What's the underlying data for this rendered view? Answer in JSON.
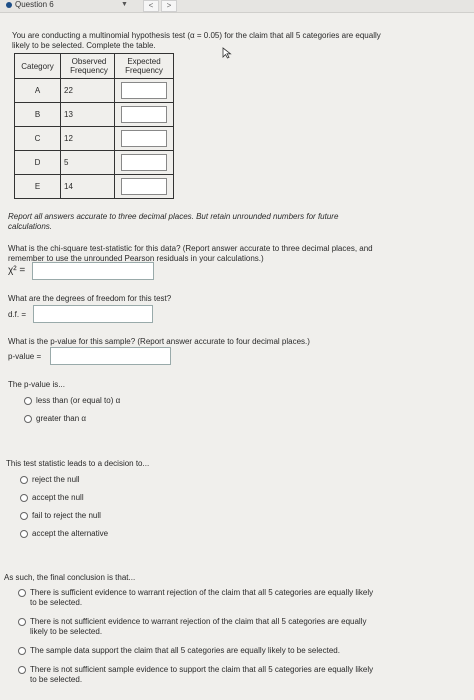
{
  "header": {
    "question_label": "Question 6",
    "prev": "<",
    "next": ">",
    "caret": "▼"
  },
  "intro": {
    "line1": "You are conducting a multinomial hypothesis test (α = 0.05) for the claim that all 5 categories are equally",
    "line2": "likely to be selected. Complete the table."
  },
  "table": {
    "headers": [
      "Category",
      "Observed Frequency",
      "Expected Frequency"
    ],
    "rows": [
      {
        "category": "A",
        "observed": "22"
      },
      {
        "category": "B",
        "observed": "13"
      },
      {
        "category": "C",
        "observed": "12"
      },
      {
        "category": "D",
        "observed": "5"
      },
      {
        "category": "E",
        "observed": "14"
      }
    ]
  },
  "report_note": {
    "line1": "Report all answers accurate to three decimal places. But retain unrounded numbers for future",
    "line2": "calculations."
  },
  "chi": {
    "line1": "What is the chi-square test-statistic for this data? (Report answer accurate to three decimal places, and",
    "line2": "remember to use the unrounded Pearson residuals in your calculations.)",
    "label": "χ² ="
  },
  "df": {
    "question": "What are the degrees of freedom for this test?",
    "label": "d.f. ="
  },
  "pval": {
    "question": "What is the p-value for this sample? (Report answer accurate to four decimal places.)",
    "label": "p-value ="
  },
  "pvalue_cmp": {
    "prompt": "The p-value is...",
    "options": [
      "less than (or equal to) α",
      "greater than α"
    ]
  },
  "decision": {
    "prompt": "This test statistic leads to a decision to...",
    "options": [
      "reject the null",
      "accept the null",
      "fail to reject the null",
      "accept the alternative"
    ]
  },
  "conclusion": {
    "prompt": "As such, the final conclusion is that...",
    "options": [
      {
        "l1": "There is sufficient evidence to warrant rejection of the claim that all 5 categories are equally likely",
        "l2": "to be selected."
      },
      {
        "l1": "There is not sufficient evidence to warrant rejection of the claim that all 5 categories are equally",
        "l2": "likely to be selected."
      },
      {
        "l1": "The sample data support the claim that all 5 categories are equally likely to be selected.",
        "l2": ""
      },
      {
        "l1": "There is not sufficient sample evidence to support the claim that all 5 categories are equally likely",
        "l2": "to be selected."
      }
    ]
  }
}
